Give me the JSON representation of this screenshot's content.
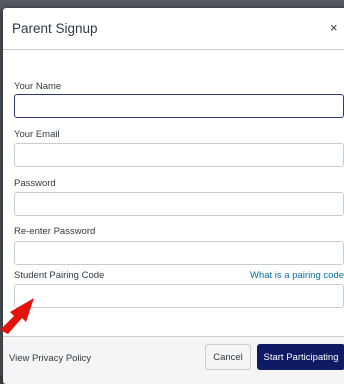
{
  "modal": {
    "title": "Parent Signup",
    "close_glyph": "×"
  },
  "fields": {
    "name_label": "Your Name",
    "email_label": "Your Email",
    "password_label": "Password",
    "reenter_label": "Re-enter Password",
    "pairing_label": "Student Pairing Code",
    "pairing_help": "What is a pairing code?"
  },
  "footer": {
    "privacy": "View Privacy Policy",
    "cancel": "Cancel",
    "submit": "Start Participating"
  },
  "colors": {
    "primary": "#0e1a63",
    "link": "#0770a3",
    "annotation_arrow": "#e3130b"
  },
  "icons": {
    "close": "close-icon",
    "arrow": "red-arrow-annotation"
  }
}
